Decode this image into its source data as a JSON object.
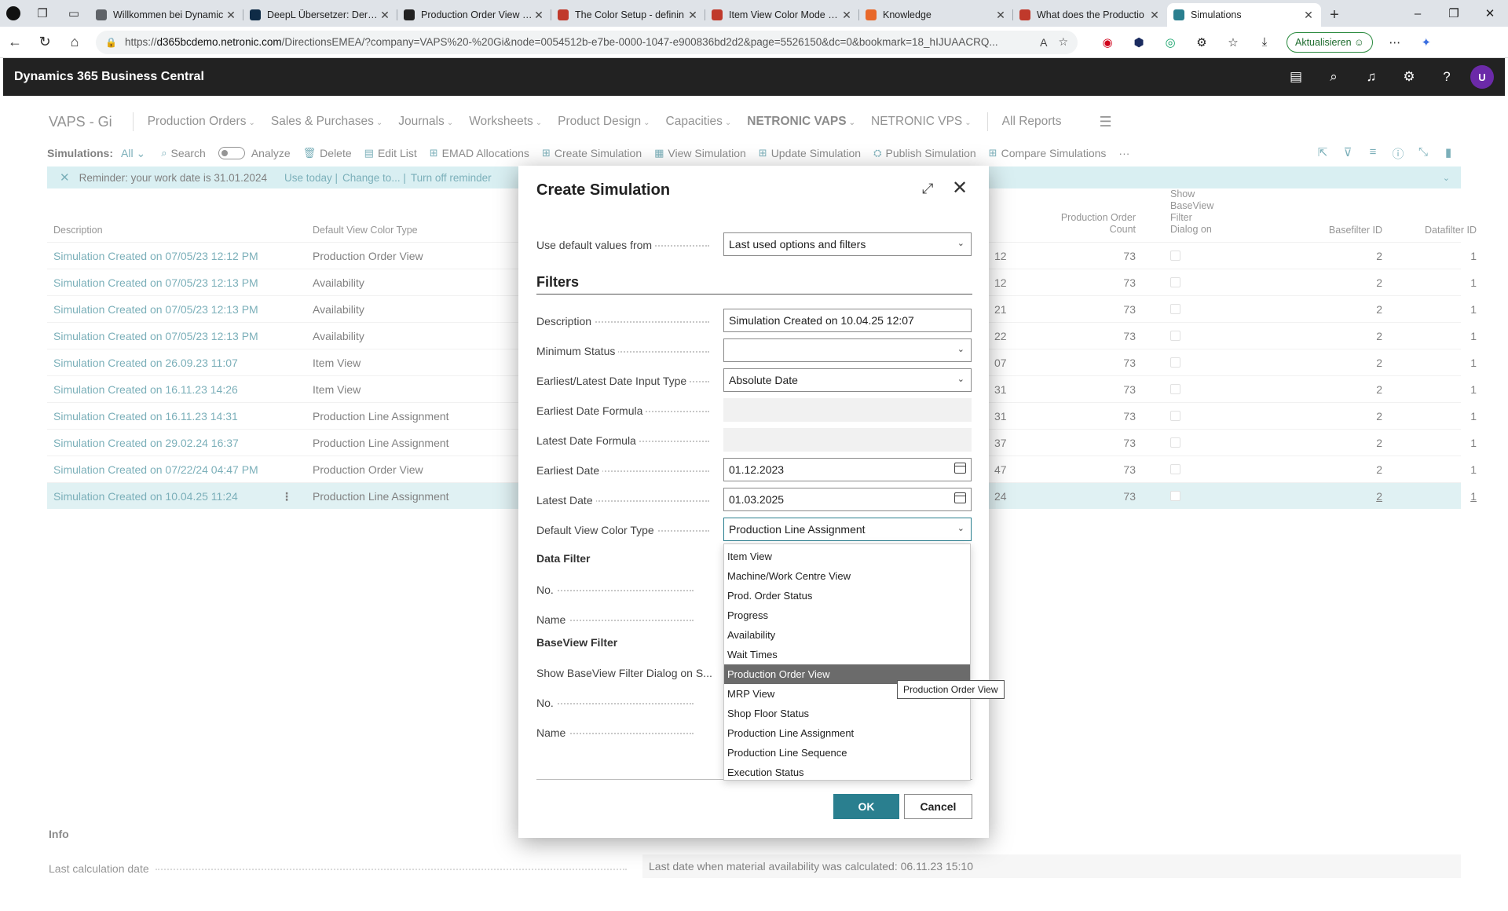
{
  "browser": {
    "tabs": [
      {
        "title": "Willkommen bei Dynamic",
        "fav_color": "#5f6368"
      },
      {
        "title": "DeepL Übersetzer: Der pr",
        "fav_color": "#0f2b46"
      },
      {
        "title": "Production Order View Se",
        "fav_color": "#222222"
      },
      {
        "title": "The Color Setup - definin",
        "fav_color": "#c0392b"
      },
      {
        "title": "Item View Color Mode - V",
        "fav_color": "#c0392b"
      },
      {
        "title": "Knowledge",
        "fav_color": "#e8682a"
      },
      {
        "title": "What does the Productio",
        "fav_color": "#c0392b"
      },
      {
        "title": "Simulations",
        "fav_color": "#2a7f8f"
      }
    ],
    "url_prefix": "https://",
    "url_host": "d365bcdemo.netronic.com",
    "url_rest": "/DirectionsEMEA/?company=VAPS%20-%20Gi&node=0054512b-e7be-0000-1047-e900836bd2d2&page=5526150&dc=0&bookmark=18_hIJUAACRQ...",
    "update_label": "Aktualisieren"
  },
  "app": {
    "title": "Dynamics 365 Business Central",
    "avatar": "U",
    "company": "VAPS - Gi",
    "menus": [
      {
        "label": "Production Orders",
        "chev": true,
        "bold": false
      },
      {
        "label": "Sales & Purchases",
        "chev": true,
        "bold": false
      },
      {
        "label": "Journals",
        "chev": true,
        "bold": false
      },
      {
        "label": "Worksheets",
        "chev": true,
        "bold": false
      },
      {
        "label": "Product Design",
        "chev": true,
        "bold": false
      },
      {
        "label": "Capacities",
        "chev": true,
        "bold": false
      },
      {
        "label": "NETRONIC VAPS",
        "chev": true,
        "bold": true
      },
      {
        "label": "NETRONIC VPS",
        "chev": true,
        "bold": false
      }
    ],
    "all_reports": "All Reports"
  },
  "actionbar": {
    "label": "Simulations:",
    "filter": "All",
    "search": "Search",
    "analyze": "Analyze",
    "actions": [
      "Delete",
      "Edit List",
      "EMAD Allocations",
      "Create Simulation",
      "View Simulation",
      "Update Simulation",
      "Publish Simulation",
      "Compare Simulations"
    ],
    "more": "···"
  },
  "reminder": {
    "text": "Reminder: your work date is 31.01.2024",
    "use_today": "Use today |",
    "change_to": "Change to... |",
    "turn_off": "Turn off reminder"
  },
  "table": {
    "headers": {
      "description": "Description",
      "color_type": "Default View Color Type",
      "count_l1": "Production Order",
      "count_l2": "Count",
      "show_l1": "Show",
      "show_l2": "BaseView",
      "show_l3": "Filter",
      "show_l4": "Dialog on",
      "basefilter": "Basefilter ID",
      "datafilter": "Datafilter ID"
    },
    "rows": [
      {
        "description": "Simulation Created on 07/05/23 12:12 PM",
        "color_type": "Production Order View",
        "time": "12",
        "count": "73",
        "basefilter": "2",
        "datafilter": "1",
        "selected": false
      },
      {
        "description": "Simulation Created on 07/05/23 12:13 PM",
        "color_type": "Availability",
        "time": "12",
        "count": "73",
        "basefilter": "2",
        "datafilter": "1",
        "selected": false
      },
      {
        "description": "Simulation Created on 07/05/23 12:13 PM",
        "color_type": "Availability",
        "time": "21",
        "count": "73",
        "basefilter": "2",
        "datafilter": "1",
        "selected": false
      },
      {
        "description": "Simulation Created on 07/05/23 12:13 PM",
        "color_type": "Availability",
        "time": "22",
        "count": "73",
        "basefilter": "2",
        "datafilter": "1",
        "selected": false
      },
      {
        "description": "Simulation Created on 26.09.23 11:07",
        "color_type": "Item View",
        "time": "07",
        "count": "73",
        "basefilter": "2",
        "datafilter": "1",
        "selected": false
      },
      {
        "description": "Simulation Created on 16.11.23 14:26",
        "color_type": "Item View",
        "time": "31",
        "count": "73",
        "basefilter": "2",
        "datafilter": "1",
        "selected": false
      },
      {
        "description": "Simulation Created on 16.11.23 14:31",
        "color_type": "Production Line Assignment",
        "time": "31",
        "count": "73",
        "basefilter": "2",
        "datafilter": "1",
        "selected": false
      },
      {
        "description": "Simulation Created on 29.02.24 16:37",
        "color_type": "Production Line Assignment",
        "time": "37",
        "count": "73",
        "basefilter": "2",
        "datafilter": "1",
        "selected": false
      },
      {
        "description": "Simulation Created on 07/22/24 04:47 PM",
        "color_type": "Production Order View",
        "time": "47",
        "count": "73",
        "basefilter": "2",
        "datafilter": "1",
        "selected": false
      },
      {
        "description": "Simulation Created on 10.04.25 11:24",
        "color_type": "Production Line Assignment",
        "time": "24",
        "count": "73",
        "basefilter": "2",
        "datafilter": "1",
        "selected": true
      }
    ]
  },
  "info": {
    "title": "Info",
    "last_calc_label": "Last calculation date",
    "last_calc_value": "Last date when material availability was calculated: 06.11.23 15:10"
  },
  "dialog": {
    "title": "Create Simulation",
    "use_default_label": "Use default values from",
    "use_default_value": "Last used options and filters",
    "filters_title": "Filters",
    "description_label": "Description",
    "description_value": "Simulation Created on 10.04.25 12:07",
    "min_status_label": "Minimum Status",
    "min_status_value": "",
    "date_input_type_label": "Earliest/Latest Date Input Type",
    "date_input_type_value": "Absolute Date",
    "earliest_formula_label": "Earliest Date Formula",
    "latest_formula_label": "Latest Date Formula",
    "earliest_date_label": "Earliest Date",
    "earliest_date_value": "01.12.2023",
    "latest_date_label": "Latest Date",
    "latest_date_value": "01.03.2025",
    "color_type_label": "Default View Color Type",
    "color_type_value": "Production Line Assignment",
    "data_filter_title": "Data Filter",
    "no_label": "No.",
    "name_label": "Name",
    "baseview_title": "BaseView Filter",
    "show_dialog_label": "Show BaseView Filter Dialog on S...",
    "ok": "OK",
    "cancel": "Cancel"
  },
  "dropdown": {
    "options": [
      "Item View",
      "Machine/Work Centre View",
      "Prod. Order Status",
      "Progress",
      "Availability",
      "Wait Times",
      "Production Order View",
      "MRP View",
      "Shop Floor Status",
      "Production Line Assignment",
      "Production Line Sequence",
      "Execution Status"
    ],
    "highlighted_index": 6,
    "tooltip": "Production Order View"
  }
}
